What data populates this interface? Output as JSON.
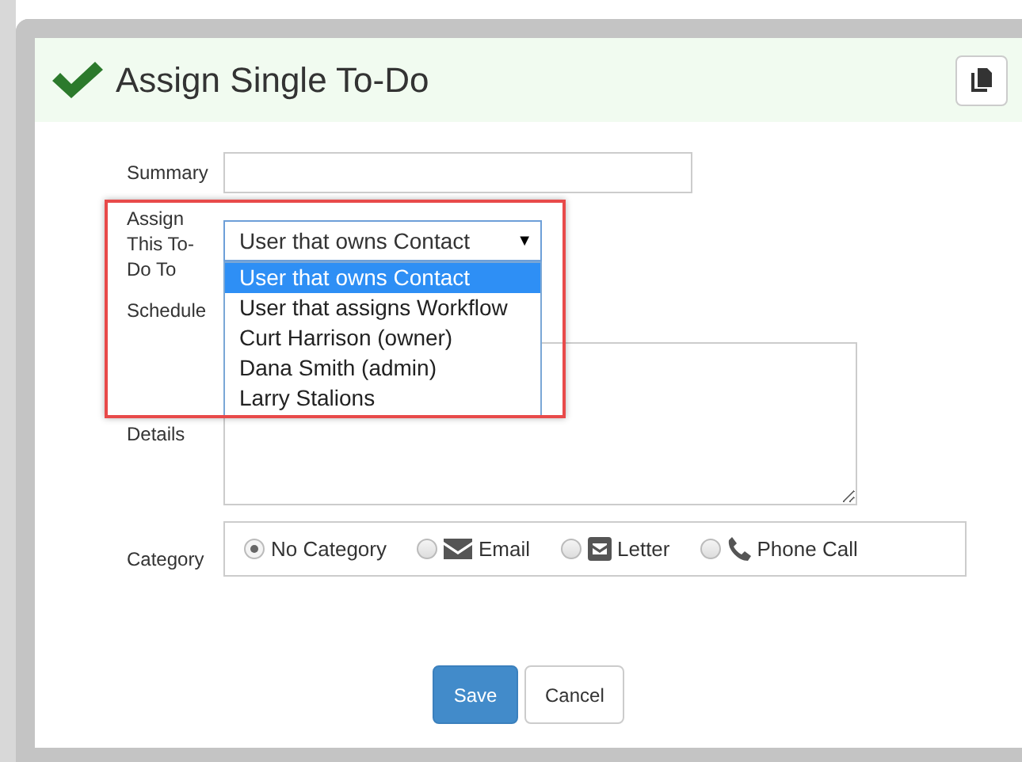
{
  "dialog": {
    "title": "Assign Single To-Do"
  },
  "summary": {
    "label": "Summary"
  },
  "assign": {
    "label": "Assign This To-Do To",
    "value": "User that owns Contact",
    "arrow": "▼",
    "expanded": true,
    "options": [
      {
        "label": "User that owns Contact",
        "selected": true
      },
      {
        "label": "User that assigns Workflow",
        "selected": false
      },
      {
        "label": "Curt Harrison (owner)",
        "selected": false
      },
      {
        "label": "Dana Smith (admin)",
        "selected": false
      },
      {
        "label": "Larry Stalions",
        "selected": false
      }
    ]
  },
  "schedule": {
    "label": "Schedule"
  },
  "details": {
    "label": "Details"
  },
  "category": {
    "label": "Category",
    "options": [
      {
        "label": "No Category",
        "kind": "plain",
        "selected": true
      },
      {
        "label": "Email",
        "kind": "email",
        "selected": false
      },
      {
        "label": "Letter",
        "kind": "letter",
        "selected": false
      },
      {
        "label": "Phone Call",
        "kind": "phone",
        "selected": false
      }
    ]
  },
  "buttons": [
    {
      "label": "Save",
      "kind": "primary"
    },
    {
      "label": "Cancel",
      "kind": "default"
    }
  ]
}
